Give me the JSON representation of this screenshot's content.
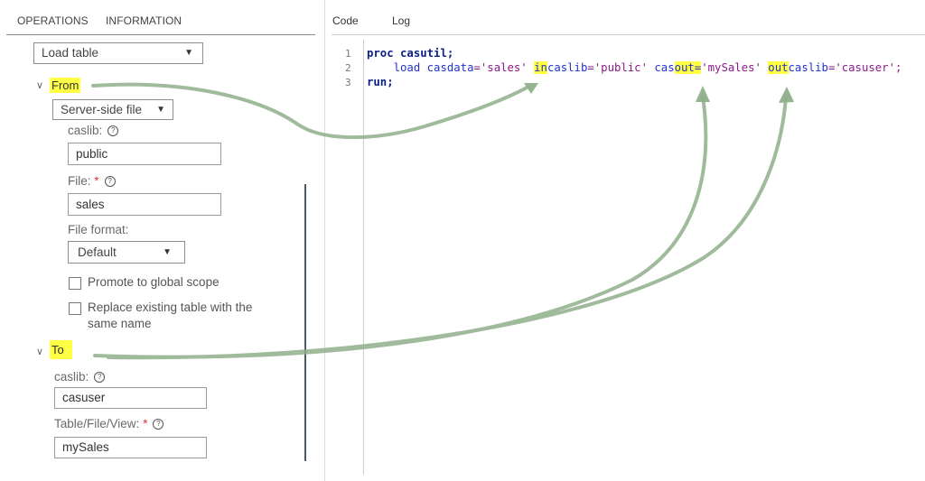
{
  "tabs": {
    "operations": "OPERATIONS",
    "information": "INFORMATION"
  },
  "operation_select": {
    "value": "Load table"
  },
  "from": {
    "title": "From",
    "source_select": "Server-side file",
    "caslib_label": "caslib:",
    "caslib_value": "public",
    "file_label": "File:",
    "file_required": "*",
    "file_value": "sales",
    "format_label": "File format:",
    "format_value": "Default",
    "promote_label": "Promote to global scope",
    "replace_label_line1": "Replace existing table with the",
    "replace_label_line2": "same name"
  },
  "to": {
    "title": "To",
    "caslib_label": "caslib:",
    "caslib_value": "casuser",
    "table_label": "Table/File/View:",
    "table_required": "*",
    "table_value": "mySales"
  },
  "editor": {
    "tabs": {
      "code": "Code",
      "log": "Log"
    },
    "line_numbers": [
      "1",
      "2",
      "3"
    ],
    "line1": {
      "kw1": "proc",
      "rest": " casutil;"
    },
    "line2": {
      "indent": "    ",
      "load": "load ",
      "casdata_kw": "casdata",
      "casdata_val": "='sales' ",
      "in_hl": "in",
      "incaslib_rest": "caslib",
      "incaslib_val": "='public' ",
      "cas": "cas",
      "out_hl": "out=",
      "casout_val": "'mySales' ",
      "out2_hl": "out",
      "outcaslib_rest": "caslib",
      "outcaslib_val": "='casuser';"
    },
    "line3": {
      "kw": "run",
      "rest": ";"
    }
  },
  "colors": {
    "highlight": "#ffff44",
    "arrow": "#8fb08a"
  }
}
